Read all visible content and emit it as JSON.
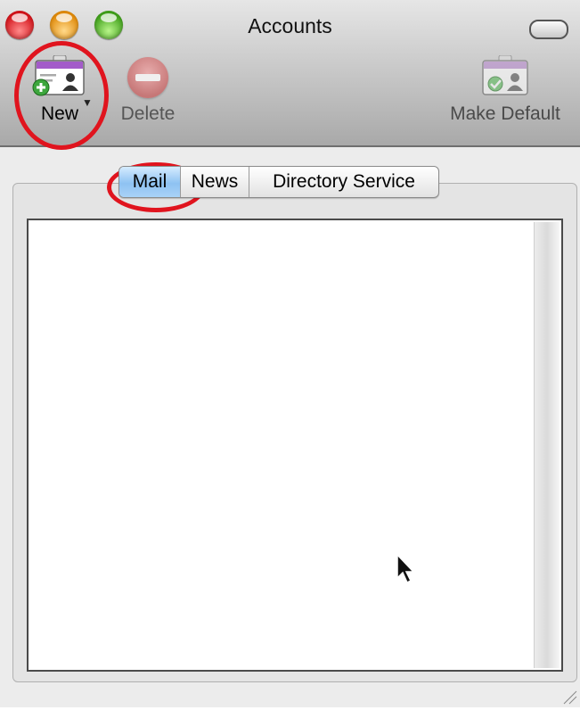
{
  "window": {
    "title": "Accounts"
  },
  "toolbar": {
    "new_label": "New",
    "delete_label": "Delete",
    "make_default_label": "Make Default",
    "new_icon": "new-account-card-icon",
    "delete_icon": "delete-icon",
    "make_default_icon": "make-default-card-icon"
  },
  "tabs": [
    {
      "label": "Mail",
      "selected": true
    },
    {
      "label": "News",
      "selected": false
    },
    {
      "label": "Directory Service",
      "selected": false
    }
  ],
  "accounts_list": {
    "items": []
  },
  "colors": {
    "annotation": "#e0141e",
    "selected_tab": "#8ec2f2"
  }
}
